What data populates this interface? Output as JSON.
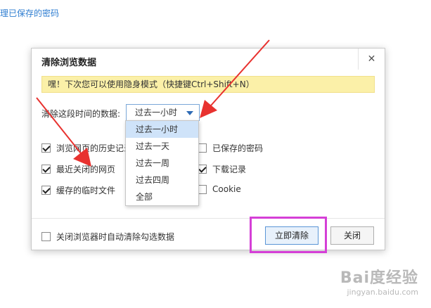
{
  "background": {
    "link_text": "理已保存的密码"
  },
  "dialog": {
    "title": "清除浏览数据",
    "close_glyph": "✕",
    "banner": "嘿！下次您可以使用隐身模式（快捷键Ctrl+Shift+N）",
    "range_label": "清除这段时间的数据:",
    "range_selected": "过去一小时",
    "range_options": [
      "过去一小时",
      "过去一天",
      "过去一周",
      "过去四周",
      "全部"
    ],
    "checkboxes": [
      {
        "label": "浏览网页的历史记录",
        "checked": true
      },
      {
        "label": "最近关闭的网页",
        "checked": true
      },
      {
        "label": "缓存的临时文件",
        "checked": true
      },
      {
        "label": "已保存的密码",
        "checked": false
      },
      {
        "label": "下载记录",
        "checked": true
      },
      {
        "label": "Cookie",
        "checked": false
      }
    ],
    "auto_clear_label": "关闭浏览器时自动清除勾选数据",
    "auto_clear_checked": false,
    "clear_button": "立即清除",
    "close_button": "关闭"
  },
  "annotation_colors": {
    "arrow": "#e8322f",
    "highlight": "#d53fd7"
  },
  "watermark": {
    "logo": "Bai度经验",
    "url": "jingyan.baidu.com"
  }
}
